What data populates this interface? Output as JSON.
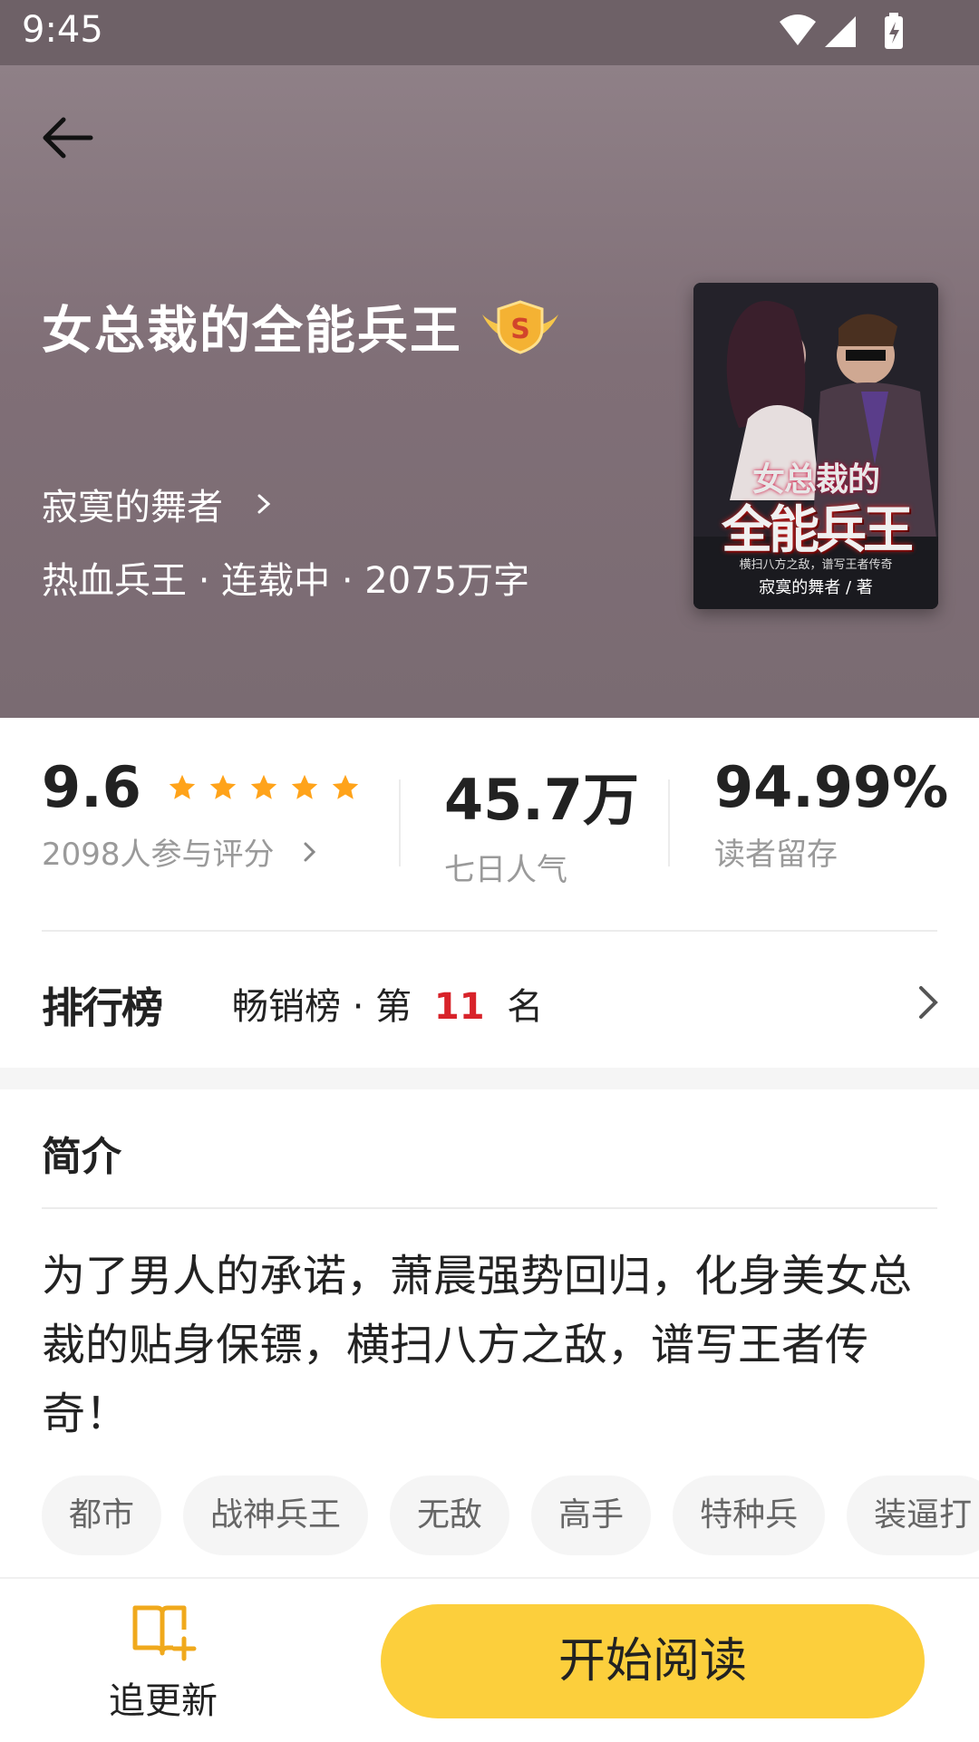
{
  "status_bar": {
    "time": "9:45"
  },
  "book": {
    "title": "女总裁的全能兵王",
    "author": "寂寞的舞者",
    "meta": "热血兵王 · 连载中 · 2075万字",
    "cover": {
      "title_line1": "女总裁的",
      "title_line2": "全能兵王",
      "tagline": "横扫八方之敌，谱写王者传奇",
      "author_credit": "寂寞的舞者 / 著"
    }
  },
  "stats": {
    "rating": {
      "value": "9.6",
      "stars": 5,
      "sub": "2098人参与评分"
    },
    "popularity": {
      "value": "45.7万",
      "label": "七日人气"
    },
    "retention": {
      "value": "94.99%",
      "label": "读者留存"
    }
  },
  "ranking": {
    "logo": "排行榜",
    "list": "畅销榜",
    "prefix": "· 第",
    "rank": "11",
    "suffix": "名"
  },
  "intro": {
    "heading": "简介",
    "text": "为了男人的承诺，萧晨强势回归，化身美女总裁的贴身保镖，横扫八方之敌，谱写王者传奇！",
    "tags": [
      "都市",
      "战神兵王",
      "无敌",
      "高手",
      "特种兵",
      "装逼打"
    ]
  },
  "bottom_bar": {
    "follow_label": "追更新",
    "read_label": "开始阅读"
  },
  "colors": {
    "accent_yellow": "#fccf3c",
    "rank_red": "#d8232a",
    "star_orange": "#ffa31a",
    "hero_bg": "#857680"
  }
}
